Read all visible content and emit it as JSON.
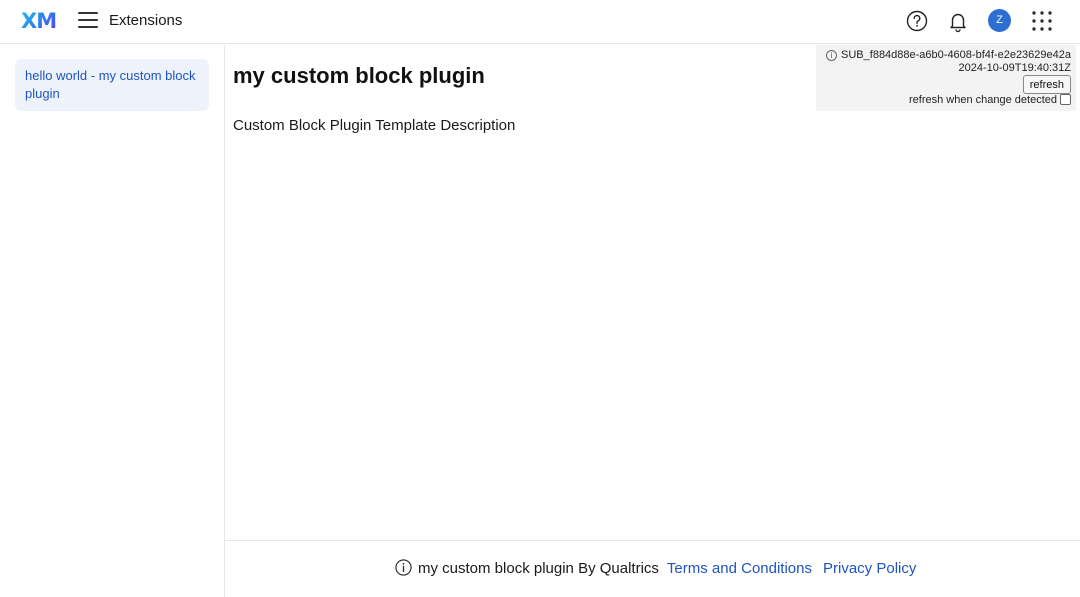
{
  "header": {
    "logo_text": "XM",
    "title": "Extensions",
    "avatar_initial": "Z",
    "icons": [
      "hamburger-menu-icon",
      "help-icon",
      "bell-icon",
      "apps-grid-icon"
    ]
  },
  "sidebar": {
    "items": [
      {
        "label": "hello world - my custom block plugin"
      }
    ]
  },
  "main": {
    "title": "my custom block plugin",
    "description": "Custom Block Plugin Template Description"
  },
  "debug": {
    "submission_id": "SUB_f884d88e-a6b0-4608-bf4f-e2e23629e42a",
    "timestamp": "2024-10-09T19:40:31Z",
    "refresh_label": "refresh",
    "auto_refresh_label": "refresh when change detected"
  },
  "footer": {
    "text": "my custom block plugin By Qualtrics",
    "terms_label": "Terms and Conditions",
    "privacy_label": "Privacy Policy"
  },
  "colors": {
    "accent": "#1f54c2",
    "avatar": "#2d6ed3",
    "sidebar_active_bg": "#edf2fb"
  }
}
